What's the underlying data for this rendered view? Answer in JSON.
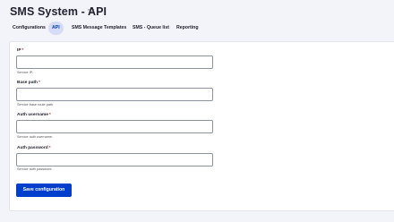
{
  "page": {
    "title": "SMS System - API",
    "star_icon": "☆"
  },
  "tabs": [
    {
      "label": "Configurations",
      "active": false
    },
    {
      "label": "API",
      "active": true
    },
    {
      "label": "SMS Message Templates",
      "active": false
    },
    {
      "label": "SMS - Queue list",
      "active": false
    },
    {
      "label": "Reporting",
      "active": false
    }
  ],
  "form": {
    "fields": [
      {
        "label": "IP",
        "required_mark": "*",
        "value": "",
        "description": "Service IP."
      },
      {
        "label": "Base path",
        "required_mark": "*",
        "value": "",
        "description": "Service base route path."
      },
      {
        "label": "Auth username",
        "required_mark": "*",
        "value": "",
        "description": "Service auth username."
      },
      {
        "label": "Auth password",
        "required_mark": "*",
        "value": "",
        "description": "Service auth password."
      }
    ],
    "submit_label": "Save configuration"
  },
  "colors": {
    "accent": "#003ecc",
    "active_tab_bg": "#d5dcf5",
    "required": "#dc2323",
    "page_bg": "#f3f4f9"
  }
}
